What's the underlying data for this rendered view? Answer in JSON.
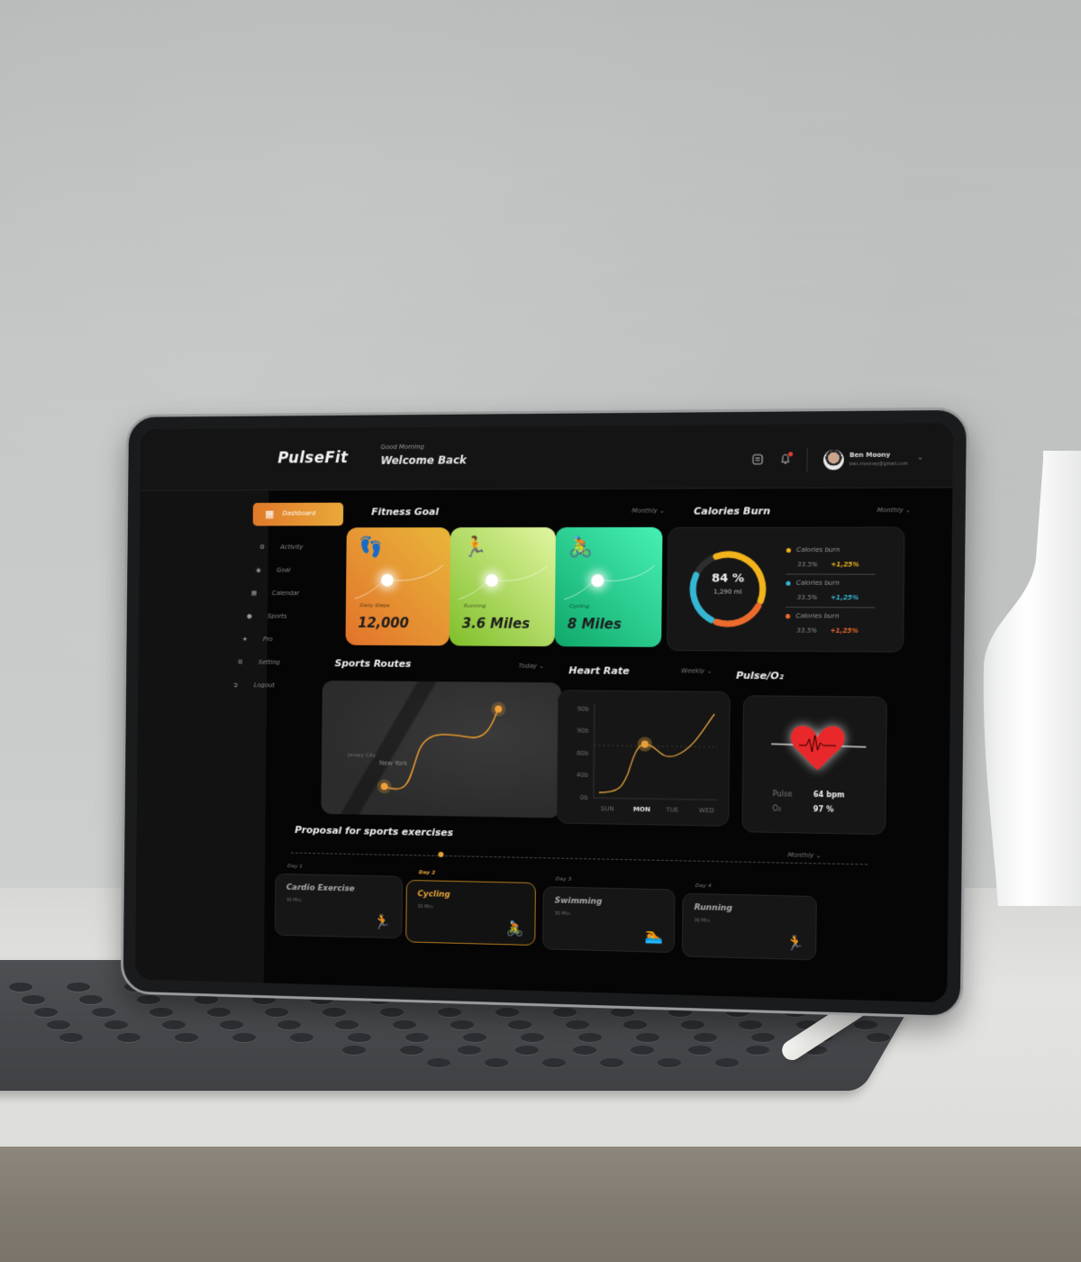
{
  "app": {
    "logo": "PulseFit",
    "greeting_small": "Good Morning",
    "greeting_big": "Welcome Back"
  },
  "header": {
    "icons": [
      "message-icon",
      "bell-icon"
    ],
    "has_notification": true,
    "user": {
      "name": "Ben Moony",
      "email": "ben.mooney@gmail.com"
    }
  },
  "sidebar": {
    "items": [
      {
        "label": "Dashboard",
        "icon": "grid-icon",
        "active": true
      },
      {
        "label": "Activity",
        "icon": "activity-icon"
      },
      {
        "label": "Goal",
        "icon": "goal-icon"
      },
      {
        "label": "Calendar",
        "icon": "calendar-icon"
      },
      {
        "label": "Sports",
        "icon": "ball-icon"
      },
      {
        "label": "Pro",
        "icon": "crown-icon"
      },
      {
        "label": "Setting",
        "icon": "gear-icon"
      },
      {
        "label": "Logout",
        "icon": "logout-icon"
      }
    ]
  },
  "fitness_goal": {
    "title": "Fitness Goal",
    "period": "Monthly",
    "cards": [
      {
        "label": "Daily Steps",
        "value": "12,000",
        "icon": "footprints-icon",
        "colors": [
          "#e2732b",
          "#e9b63a"
        ]
      },
      {
        "label": "Running",
        "value": "3.6 Miles",
        "icon": "runner-icon",
        "colors": [
          "#7fbf2a",
          "#e1f5a0"
        ]
      },
      {
        "label": "Cycling",
        "value": "8 Miles",
        "icon": "cyclist-icon",
        "colors": [
          "#0fa86a",
          "#47f0b4"
        ]
      }
    ]
  },
  "calories": {
    "title": "Calories Burn",
    "period": "Monthly",
    "percent": "84 %",
    "amount": "1,290 ml",
    "segments": [
      {
        "label": "Calories burn",
        "value": "33.5%",
        "change": "+1,25%",
        "color": "#f2b31b"
      },
      {
        "label": "Calories burn",
        "value": "33.5%",
        "change": "+1,25%",
        "color": "#35b7d3"
      },
      {
        "label": "Calories burn",
        "value": "33.5%",
        "change": "+1,25%",
        "color": "#ec6a2c"
      }
    ]
  },
  "sports_routes": {
    "title": "Sports Routes",
    "period": "Today",
    "map_labels": [
      "New York",
      "Jersey City"
    ]
  },
  "heart_rate": {
    "title": "Heart Rate",
    "period": "Weekly",
    "y_ticks": [
      "90b",
      "90b",
      "80b",
      "40b",
      "0b"
    ],
    "x_ticks": [
      "SUN",
      "MON",
      "TUE",
      "WED"
    ],
    "active_day": "MON",
    "accent": "#e5a23a"
  },
  "pulse": {
    "title": "Pulse/O₂",
    "pulse_label": "Pulse",
    "pulse_value": "64 bpm",
    "o2_label": "O₂",
    "o2_value": "97 %",
    "heart_color": "#e8282b"
  },
  "proposal": {
    "title": "Proposal for sports exercises",
    "period": "Monthly",
    "days": [
      {
        "day": "Day 1",
        "name": "Cardio Exercise",
        "duration": "30 Min.",
        "icon": "treadmill-icon",
        "active": false
      },
      {
        "day": "Day 2",
        "name": "Cycling",
        "duration": "30 Min.",
        "icon": "cyclist-icon",
        "active": true
      },
      {
        "day": "Day 3",
        "name": "Swimming",
        "duration": "30 Min.",
        "icon": "swimmer-icon",
        "active": false
      },
      {
        "day": "Day 4",
        "name": "Running",
        "duration": "30 Min.",
        "icon": "runner-icon",
        "active": false
      }
    ]
  }
}
